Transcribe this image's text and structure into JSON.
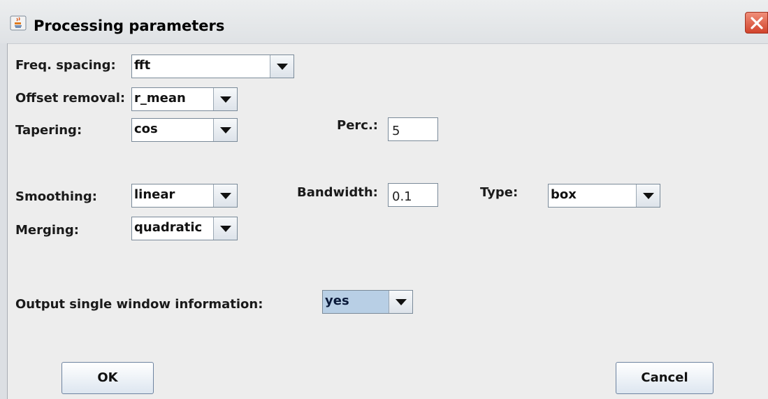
{
  "window": {
    "title": "Processing parameters",
    "icon": "java-cup-icon",
    "close_icon": "close-icon"
  },
  "rows": {
    "freq_spacing": {
      "label": "Freq. spacing:",
      "value": "fft"
    },
    "offset_removal": {
      "label": "Offset removal:",
      "value": "r_mean"
    },
    "tapering": {
      "label": "Tapering:",
      "value": "cos"
    },
    "perc": {
      "label": "Perc.:",
      "value": "5"
    },
    "smoothing": {
      "label": "Smoothing:",
      "value": "linear"
    },
    "bandwidth": {
      "label": "Bandwidth:",
      "value": "0.1"
    },
    "type": {
      "label": "Type:",
      "value": "box"
    },
    "merging": {
      "label": "Merging:",
      "value": "quadratic"
    },
    "output_single": {
      "label": "Output single window information:",
      "value": "yes"
    }
  },
  "buttons": {
    "ok": "OK",
    "cancel": "Cancel"
  },
  "colors": {
    "selection": "#b8cfe5",
    "close": "#d1432b",
    "background": "#ededed"
  }
}
